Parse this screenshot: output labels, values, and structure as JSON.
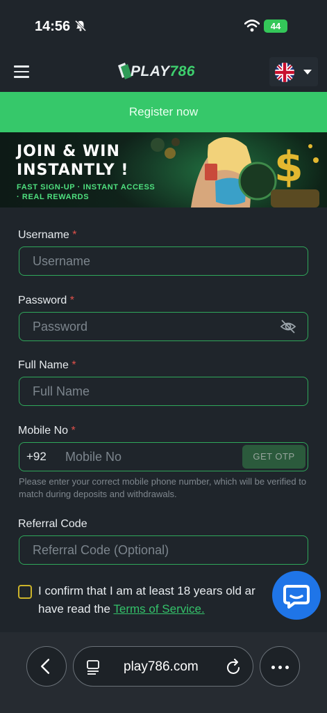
{
  "status_bar": {
    "time": "14:56",
    "battery": "44"
  },
  "nav": {
    "logo_prefix": "PLAY",
    "logo_number": "786",
    "language": "English (UK)"
  },
  "register_bar": {
    "label": "Register now"
  },
  "banner": {
    "headline_line1": "JOIN & WIN",
    "headline_line2": "INSTANTLY !",
    "sub_line1": "FAST SIGN-UP · INSTANT ACCESS",
    "sub_line2": "· REAL REWARDS"
  },
  "form": {
    "username": {
      "label": "Username",
      "required": "*",
      "placeholder": "Username"
    },
    "password": {
      "label": "Password",
      "required": "*",
      "placeholder": "Password"
    },
    "full_name": {
      "label": "Full Name",
      "required": "*",
      "placeholder": "Full Name"
    },
    "mobile": {
      "label": "Mobile No",
      "required": "*",
      "prefix": "+92",
      "placeholder": "Mobile No",
      "otp_button": "GET OTP",
      "hint": "Please enter your correct mobile phone number, which will be verified to match during deposits and withdrawals."
    },
    "referral": {
      "label": "Referral Code",
      "placeholder": "Referral Code (Optional)"
    },
    "confirm": {
      "text_before": "I confirm that I am at least 18 years old ar",
      "text_line2": "have read the ",
      "link": "Terms of Service."
    }
  },
  "browser": {
    "url": "play786.com"
  },
  "colors": {
    "accent_green": "#36c86a",
    "field_border": "#2fa85a",
    "background": "#1f252b",
    "required_red": "#e0504a",
    "chat_blue": "#1f75e8"
  }
}
